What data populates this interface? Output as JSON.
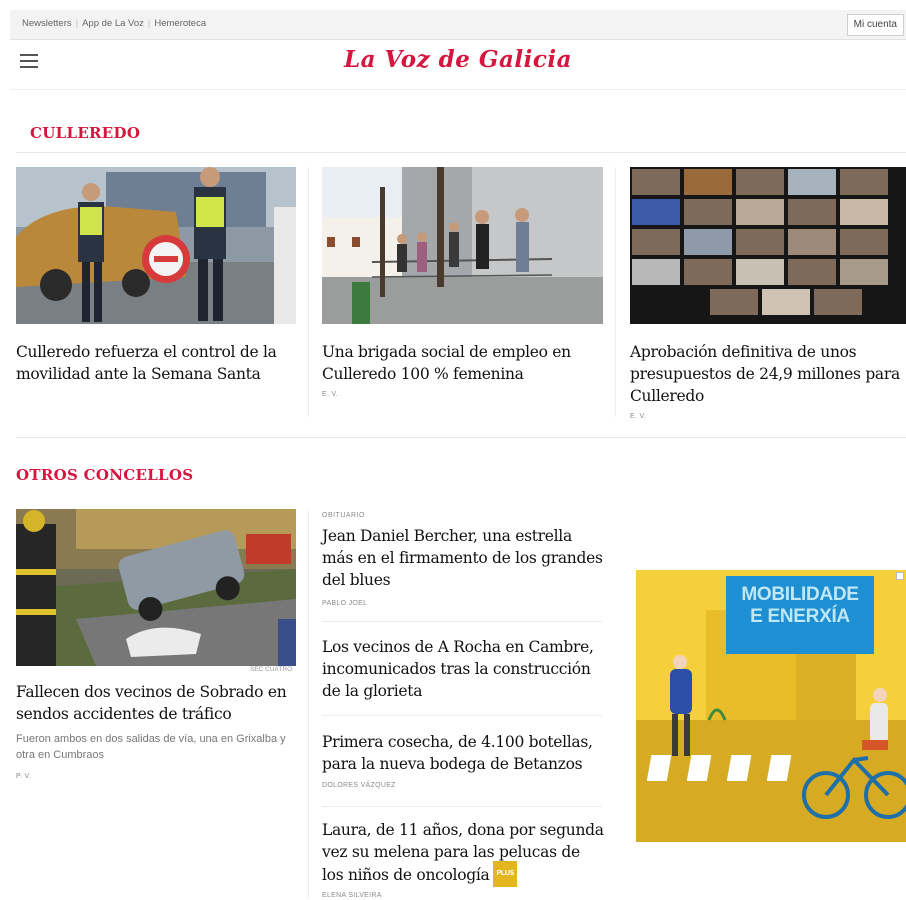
{
  "topbar": {
    "links": [
      "Newsletters",
      "App de La Voz",
      "Hemeroteca"
    ],
    "account": "Mi cuenta"
  },
  "header": {
    "logo": "La Voz de Galicia",
    "menu_icon": "hamburger-icon"
  },
  "sections": {
    "culleredo": {
      "title": "CULLEREDO",
      "articles": [
        {
          "headline": "Culleredo refuerza el control de la movilidad ante la Semana Santa",
          "byline": ""
        },
        {
          "headline": "Una brigada social de empleo en Culleredo 100 % femenina",
          "byline": "E. V."
        },
        {
          "headline": "Aprobación definitiva de unos presupuestos de 24,9 millones para Culleredo",
          "byline": "E. V."
        }
      ]
    },
    "otros": {
      "title": "OTROS CONCELLOS",
      "lead": {
        "credit": "SEC CUATRO",
        "headline": "Fallecen dos vecinos de Sobrado en sendos accidentes de tráfico",
        "summary": "Fueron ambos en dos salidas de vía, una en Grixalba y otra en Cumbraos",
        "byline": "P. V."
      },
      "list": [
        {
          "kicker": "OBITUARIO",
          "headline": "Jean Daniel Bercher, una estrella más en el firmamento de los grandes del blues",
          "byline": "PABLO JOEL"
        },
        {
          "kicker": "",
          "headline": "Los vecinos de A Rocha en Cambre, incomunicados tras la construcción de la glorieta",
          "byline": ""
        },
        {
          "kicker": "",
          "headline": "Primera cosecha, de 4.100 botellas, para la nueva bodega de Betanzos",
          "byline": "DOLORES VÁZQUEZ"
        },
        {
          "kicker": "",
          "headline": "Laura, de 11 años, dona por segunda vez su melena para las pelucas de los niños de oncología",
          "badge": "PLUS",
          "byline": "ELENA SILVEIRA"
        }
      ]
    }
  },
  "ad": {
    "line1": "MOBILIDADE",
    "line2": "E ENERXÍA"
  }
}
